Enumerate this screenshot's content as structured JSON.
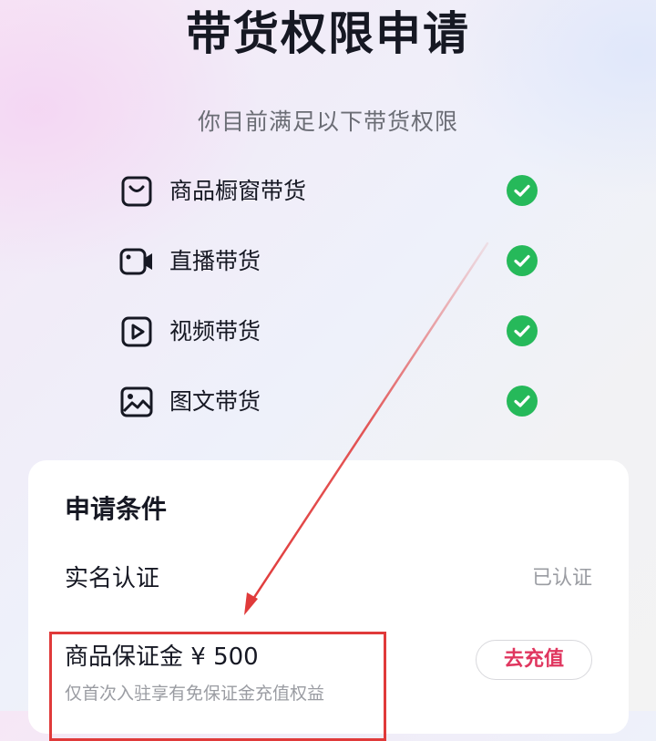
{
  "page": {
    "title": "带货权限申请",
    "subtitle": "你目前满足以下带货权限"
  },
  "permissions": [
    {
      "label": "商品橱窗带货",
      "icon": "bag-icon",
      "status": "check-circle-icon"
    },
    {
      "label": "直播带货",
      "icon": "camera-icon",
      "status": "check-circle-icon"
    },
    {
      "label": "视频带货",
      "icon": "play-icon",
      "status": "check-circle-icon"
    },
    {
      "label": "图文带货",
      "icon": "image-icon",
      "status": "check-circle-icon"
    }
  ],
  "conditions": {
    "title": "申请条件",
    "real_name": {
      "label": "实名认证",
      "status": "已认证"
    },
    "deposit": {
      "label": "商品保证金 ¥ 500",
      "note": "仅首次入驻享有免保证金充值权益",
      "button_label": "去充值"
    }
  },
  "colors": {
    "check_green": "#26b95a",
    "accent_red": "#e0365f",
    "annotation_red": "#e03a3a"
  }
}
